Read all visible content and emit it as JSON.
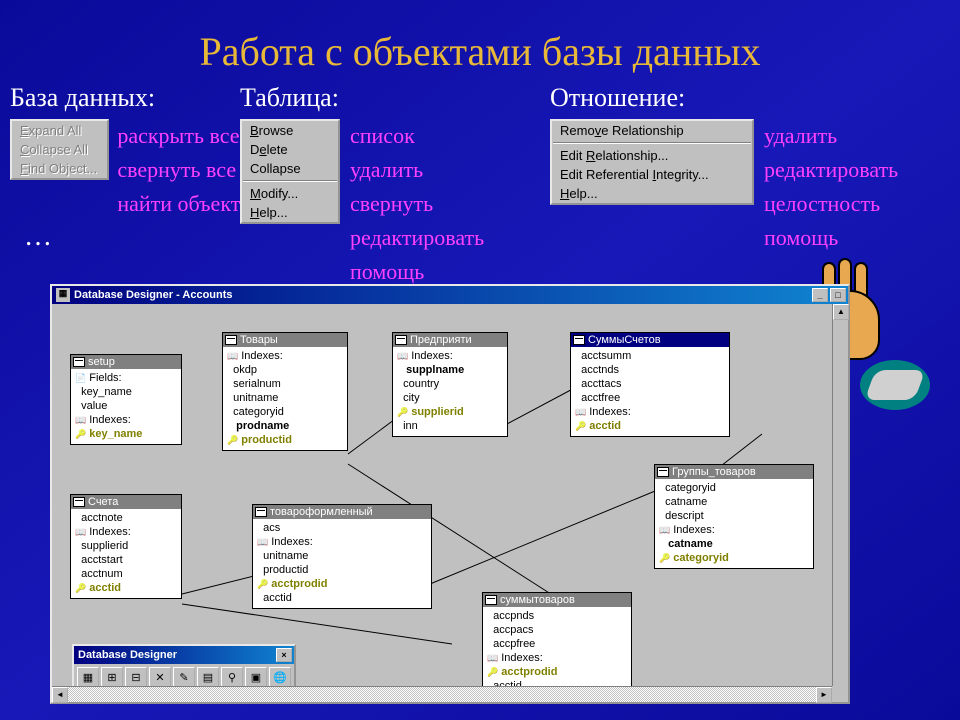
{
  "title": "Работа с объектами базы данных",
  "sections": {
    "db": {
      "label": "База данных:",
      "menu": [
        "Expand All",
        "Collapse All",
        "Find Object..."
      ],
      "ru": [
        "раскрыть все",
        "свернуть все",
        "найти объект"
      ],
      "dots": "…"
    },
    "table": {
      "label": "Таблица:",
      "menu_top": [
        "Browse",
        "Delete",
        "Collapse"
      ],
      "menu_bot": [
        "Modify...",
        "Help..."
      ],
      "ru": [
        "список",
        "удалить",
        "свернуть",
        "редактировать",
        "помощь"
      ]
    },
    "rel": {
      "label": "Отношение:",
      "menu_top": [
        "Remove Relationship"
      ],
      "menu_mid": [
        "Edit Relationship...",
        "Edit Referential Integrity...",
        "Help..."
      ],
      "ru": [
        "удалить",
        "редактировать",
        "целостность",
        "помощь"
      ]
    }
  },
  "designer": {
    "title": "Database Designer - Accounts",
    "toolbox_title": "Database Designer",
    "tables": {
      "setup": {
        "title": "setup",
        "rows": [
          "Fields:",
          "  key_name",
          "  value",
          "Indexes:"
        ],
        "key": "key_name"
      },
      "tovary": {
        "title": "Товары",
        "rows": [
          "Indexes:",
          "  okdp",
          "  serialnum",
          "  unitname",
          "  categoryid"
        ],
        "bold": "prodname",
        "key": "productid"
      },
      "pred": {
        "title": "Предприяти",
        "rows": [
          "Indexes:"
        ],
        "bold": "supplname",
        "plain": [
          "  country",
          "  city"
        ],
        "key": "supplierid",
        "extra": "  inn"
      },
      "summsch": {
        "title": "СуммыСчетов",
        "rows": [
          "  acctsumm",
          "  acctnds",
          "  accttacs",
          "  acctfree",
          "Indexes:"
        ],
        "key": "acctid"
      },
      "scheta": {
        "title": "Счета",
        "rows": [
          "  acctnote",
          "Indexes:",
          "  supplierid",
          "  acctstart",
          "  acctnum"
        ],
        "key": "acctid"
      },
      "tovoform": {
        "title": "товароформленный",
        "rows": [
          "  acs",
          "Indexes:",
          "  unitname",
          "  productid"
        ],
        "key": "acctprodid",
        "extra": "  acctid"
      },
      "summtov": {
        "title": "суммытоваров",
        "rows": [
          "  accpnds",
          "  accpacs",
          "  accpfree",
          "Indexes:"
        ],
        "key": "acctprodid",
        "extra": "  acctid"
      },
      "grupp": {
        "title": "Группы_товаров",
        "rows": [
          "  categoryid",
          "  catname",
          "  descript",
          "Indexes:"
        ],
        "bold": "catname",
        "key": "categoryid"
      }
    }
  }
}
